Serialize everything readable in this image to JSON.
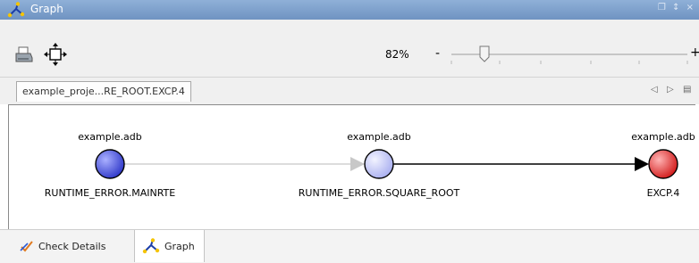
{
  "window": {
    "title": "Graph",
    "controls": "❐ ↕ ×"
  },
  "toolbar": {
    "zoom_label": "82%",
    "zoom_minus": "-",
    "zoom_plus": "+",
    "zoom_level_percent": 82
  },
  "tabs": {
    "file_tab_label": "example_proje...RE_ROOT.EXCP.4",
    "nav_prev": "◁",
    "nav_next": "▷",
    "nav_menu": "▤"
  },
  "graph": {
    "nodes": [
      {
        "top_label": "example.adb",
        "bottom_label": "RUNTIME_ERROR.MAINRTE",
        "color": "#4a56e0"
      },
      {
        "top_label": "example.adb",
        "bottom_label": "RUNTIME_ERROR.SQUARE_ROOT",
        "color": "#c9cdf6"
      },
      {
        "top_label": "example.adb",
        "bottom_label": "EXCP.4",
        "color": "#e22b2b"
      }
    ],
    "edges": [
      {
        "from": 0,
        "to": 1,
        "color": "#c8c8c8"
      },
      {
        "from": 1,
        "to": 2,
        "color": "#000000"
      }
    ]
  },
  "bottom_tabs": [
    {
      "label": "Check Details",
      "icon": "check-details-icon",
      "selected": false
    },
    {
      "label": "Graph",
      "icon": "graph-icon",
      "selected": true
    }
  ]
}
